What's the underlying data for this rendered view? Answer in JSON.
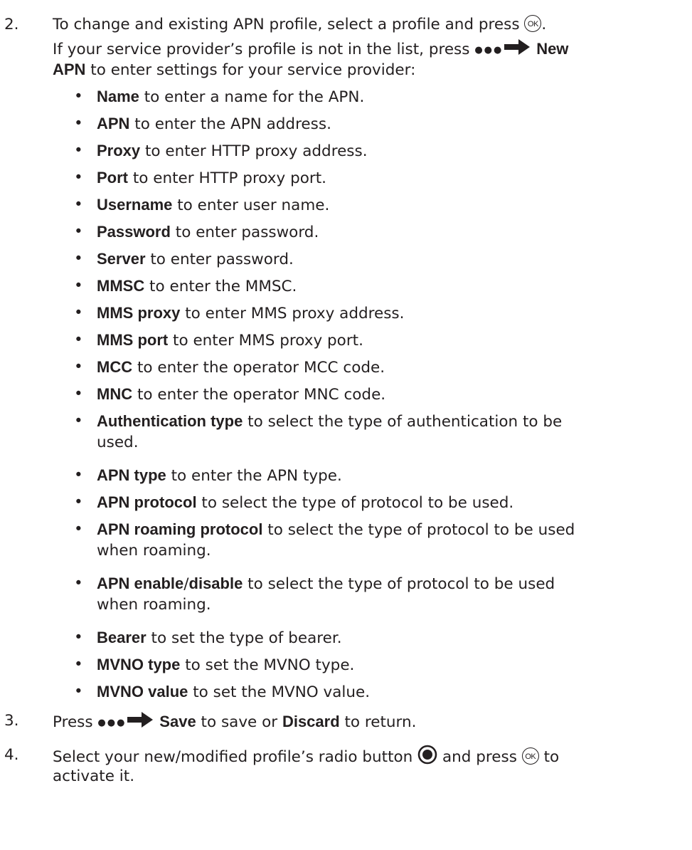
{
  "steps": [
    {
      "number": "2.",
      "line1_text": "To change and existing APN profile, select a profile and press ",
      "ok_label": "OK",
      "line1_end": ".",
      "line2_text": "If your service provider’s profile is not in the list, press ",
      "line2_bold": "New",
      "line3_bold": "APN",
      "line3_text": " to enter settings for your service provider:"
    },
    {
      "number": "3.",
      "text_before": "Press ",
      "bold1": "Save",
      "text_middle": " to save or ",
      "bold2": "Discard",
      "text_after": " to return."
    },
    {
      "number": "4.",
      "line1_text": "Select your new/modified profile’s radio button ",
      "line1_middle": " and press ",
      "ok_label": "OK",
      "line1_end": " to",
      "line2_text": "activate it."
    }
  ],
  "bullet_symbol": "•",
  "bullets": [
    {
      "bold": "Name",
      "text": " to enter a name for the APN."
    },
    {
      "bold": "APN",
      "text": " to enter the APN address."
    },
    {
      "bold": "Proxy",
      "text": " to enter HTTP proxy address."
    },
    {
      "bold": "Port",
      "text": " to enter HTTP proxy port."
    },
    {
      "bold": "Username",
      "text": " to enter user name."
    },
    {
      "bold": "Password",
      "text": " to enter password."
    },
    {
      "bold": "Server",
      "text": " to enter password."
    },
    {
      "bold": "MMSC",
      "text": " to enter the MMSC."
    },
    {
      "bold": "MMS proxy",
      "text": " to enter MMS proxy address."
    },
    {
      "bold": "MMS port",
      "text": " to enter MMS proxy port."
    },
    {
      "bold": "MCC",
      "text": " to enter the operator MCC code."
    },
    {
      "bold": "MNC",
      "text": " to enter the operator MNC code."
    },
    {
      "bold": "Authentication type",
      "text": " to select the type of authentication to be",
      "text2": "used."
    },
    {
      "bold": "APN type",
      "text": " to enter the APN type."
    },
    {
      "bold": "APN protocol",
      "text": " to select the type of protocol to be used."
    },
    {
      "bold": "APN roaming protocol",
      "text": " to select the type of protocol to be used",
      "text2": "when roaming."
    },
    {
      "bold": "APN enable",
      "sep": "/",
      "bold_b": "disable",
      "text": " to select the type of protocol to be used",
      "text2": "when roaming."
    },
    {
      "bold": "Bearer",
      "text": " to set the type of bearer."
    },
    {
      "bold": "MVNO type",
      "text": " to set the MVNO type."
    },
    {
      "bold": "MVNO value",
      "text": " to set the MVNO value."
    }
  ],
  "icons": {
    "menu": "more-options-icon",
    "arrow": "right-arrow-icon",
    "ok": "ok-button-icon",
    "radio": "radio-button-selected-icon"
  }
}
